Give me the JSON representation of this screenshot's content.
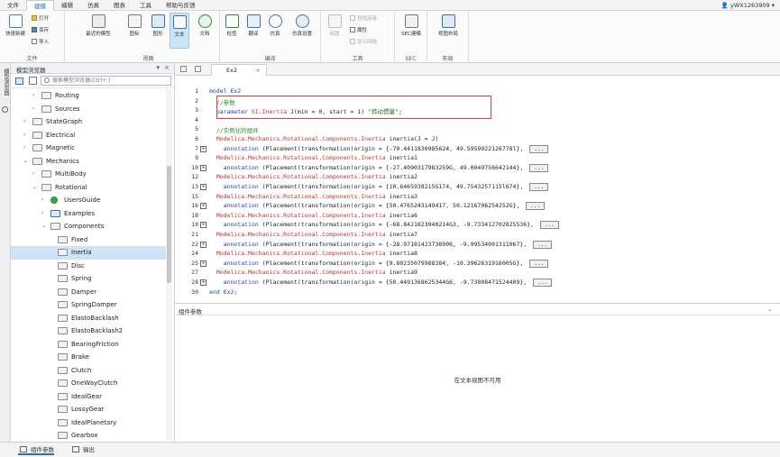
{
  "menubar": {
    "items": [
      "文件",
      "建模",
      "编辑",
      "仿真",
      "图表",
      "工具",
      "帮助与反馈"
    ],
    "active_index": 1,
    "user": "yWX1263909"
  },
  "ribbon": {
    "groups": {
      "file": {
        "label": "文件",
        "quick_new": "快速新建",
        "open": "打开",
        "save": "保存",
        "import": "导入"
      },
      "view": {
        "label": "视图",
        "recent": "最近的模型",
        "icon": "图标",
        "diagram": "图形",
        "text": "文本",
        "doc": "文档"
      },
      "compile": {
        "label": "编译",
        "check": "检查",
        "translate": "翻译",
        "simulate": "仿真",
        "sim_settings": "仿真设置"
      },
      "tools": {
        "label": "工具",
        "draw": "绘图",
        "find_conn": "查找连接",
        "props": "属性",
        "show_grid": "显示网格"
      },
      "sec": {
        "label": "SEC",
        "sec_model": "SEC建模"
      },
      "layout": {
        "label": "布局",
        "view_layout": "视图布局"
      }
    }
  },
  "sidebar": {
    "vertical_tab": "模型浏览器",
    "title": "模型浏览器",
    "search_placeholder": "搜索模型浏览器(Ctrl+;)",
    "tree": [
      {
        "label": "Routing",
        "depth": 2,
        "arrow": "›",
        "icon": "folder"
      },
      {
        "label": "Sources",
        "depth": 2,
        "arrow": "›",
        "icon": "folder"
      },
      {
        "label": "StateGraph",
        "depth": 1,
        "arrow": "›",
        "icon": "folder"
      },
      {
        "label": "Electrical",
        "depth": 1,
        "arrow": "›",
        "icon": "folder"
      },
      {
        "label": "Magnetic",
        "depth": 1,
        "arrow": "›",
        "icon": "folder"
      },
      {
        "label": "Mechanics",
        "depth": 1,
        "arrow": "⌄",
        "icon": "folder"
      },
      {
        "label": "MultiBody",
        "depth": 2,
        "arrow": "›",
        "icon": "folder"
      },
      {
        "label": "Rotational",
        "depth": 2,
        "arrow": "⌄",
        "icon": "folder"
      },
      {
        "label": "UsersGuide",
        "depth": 3,
        "arrow": "›",
        "icon": "info"
      },
      {
        "label": "Examples",
        "depth": 3,
        "arrow": "›",
        "icon": "play"
      },
      {
        "label": "Components",
        "depth": 3,
        "arrow": "⌄",
        "icon": "folder"
      },
      {
        "label": "Fixed",
        "depth": 4,
        "arrow": "",
        "icon": "component"
      },
      {
        "label": "Inertia",
        "depth": 4,
        "arrow": "",
        "icon": "component",
        "selected": true
      },
      {
        "label": "Disc",
        "depth": 4,
        "arrow": "",
        "icon": "component"
      },
      {
        "label": "Spring",
        "depth": 4,
        "arrow": "",
        "icon": "component"
      },
      {
        "label": "Damper",
        "depth": 4,
        "arrow": "",
        "icon": "component"
      },
      {
        "label": "SpringDamper",
        "depth": 4,
        "arrow": "",
        "icon": "component"
      },
      {
        "label": "ElastoBacklash",
        "depth": 4,
        "arrow": "",
        "icon": "component"
      },
      {
        "label": "ElastoBacklash2",
        "depth": 4,
        "arrow": "",
        "icon": "component"
      },
      {
        "label": "BearingFriction",
        "depth": 4,
        "arrow": "",
        "icon": "component"
      },
      {
        "label": "Brake",
        "depth": 4,
        "arrow": "",
        "icon": "component"
      },
      {
        "label": "Clutch",
        "depth": 4,
        "arrow": "",
        "icon": "component"
      },
      {
        "label": "OneWayClutch",
        "depth": 4,
        "arrow": "",
        "icon": "component"
      },
      {
        "label": "IdealGear",
        "depth": 4,
        "arrow": "",
        "icon": "component"
      },
      {
        "label": "LossyGear",
        "depth": 4,
        "arrow": "",
        "icon": "component"
      },
      {
        "label": "IdealPlanetary",
        "depth": 4,
        "arrow": "",
        "icon": "component"
      },
      {
        "label": "Gearbox",
        "depth": 4,
        "arrow": "",
        "icon": "component"
      }
    ]
  },
  "editor": {
    "tab": "Ex2",
    "lines": [
      {
        "n": "1",
        "parts": [
          {
            "c": "kw",
            "t": "model Ex2"
          }
        ]
      },
      {
        "n": "2",
        "parts": [
          {
            "c": "cm",
            "t": "  //参数"
          }
        ]
      },
      {
        "n": "3",
        "parts": [
          {
            "c": "kw",
            "t": "  parameter "
          },
          {
            "c": "tp",
            "t": "SI.Inertia"
          },
          {
            "c": "",
            "t": " J(min = 0, start = 1) "
          },
          {
            "c": "st",
            "t": "\"转动惯量\""
          },
          {
            "c": "",
            "t": ";"
          }
        ]
      },
      {
        "n": "4",
        "parts": []
      },
      {
        "n": "5",
        "parts": [
          {
            "c": "cm",
            "t": "  //实例化的组件"
          }
        ]
      },
      {
        "n": "6",
        "parts": [
          {
            "c": "tp",
            "t": "  Modelica.Mechanics.Rotational.Components.Inertia"
          },
          {
            "c": "",
            "t": " inertia(J = J)"
          }
        ]
      },
      {
        "n": "7",
        "fold": true,
        "parts": [
          {
            "c": "kw",
            "t": "    annotation"
          },
          {
            "c": "",
            "t": " (Placement(transformation(origin = {-70.4411830985624, 49.5959922126778l}, "
          }
        ],
        "ellip": "..."
      },
      {
        "n": "9",
        "parts": [
          {
            "c": "tp",
            "t": "  Modelica.Mechanics.Rotational.Components.Inertia"
          },
          {
            "c": "",
            "t": " inertia1"
          }
        ]
      },
      {
        "n": "10",
        "fold": true,
        "parts": [
          {
            "c": "kw",
            "t": "    annotation"
          },
          {
            "c": "",
            "t": " (Placement(transformation(origin = {-27.4090317983259G, 49.0049756642144}, "
          }
        ],
        "ellip": "..."
      },
      {
        "n": "12",
        "parts": [
          {
            "c": "tp",
            "t": "  Modelica.Mechanics.Rotational.Components.Inertia"
          },
          {
            "c": "",
            "t": " inertia2"
          }
        ]
      },
      {
        "n": "13",
        "fold": true,
        "parts": [
          {
            "c": "kw",
            "t": "    annotation"
          },
          {
            "c": "",
            "t": " (Placement(transformation(origin = {10.6465938215G174, 49.7543257115l674}, "
          }
        ],
        "ellip": "..."
      },
      {
        "n": "15",
        "parts": [
          {
            "c": "tp",
            "t": "  Modelica.Mechanics.Rotational.Components.Inertia"
          },
          {
            "c": "",
            "t": " inertia3"
          }
        ]
      },
      {
        "n": "16",
        "fold": true,
        "parts": [
          {
            "c": "kw",
            "t": "    annotation"
          },
          {
            "c": "",
            "t": " (Placement(transformation(origin = {50.4765243149417, 50.1216706254252G}, "
          }
        ],
        "ellip": "..."
      },
      {
        "n": "18",
        "parts": [
          {
            "c": "tp",
            "t": "  Modelica.Mechanics.Rotational.Components.Inertia"
          },
          {
            "c": "",
            "t": " inertia6"
          }
        ]
      },
      {
        "n": "19",
        "fold": true,
        "parts": [
          {
            "c": "kw",
            "t": "    annotation"
          },
          {
            "c": "",
            "t": " (Placement(transformation(origin = {-68.8421623940214G3, -9.733412702825536}, "
          }
        ],
        "ellip": "..."
      },
      {
        "n": "21",
        "parts": [
          {
            "c": "tp",
            "t": "  Modelica.Mechanics.Rotational.Components.Inertia"
          },
          {
            "c": "",
            "t": " inertia7"
          }
        ]
      },
      {
        "n": "22",
        "fold": true,
        "parts": [
          {
            "c": "kw",
            "t": "    annotation"
          },
          {
            "c": "",
            "t": " (Placement(transformation(origin = {-28.97181423738906, -9.99534001311067}, "
          }
        ],
        "ellip": "..."
      },
      {
        "n": "24",
        "parts": [
          {
            "c": "tp",
            "t": "  Modelica.Mechanics.Rotational.Components.Inertia"
          },
          {
            "c": "",
            "t": " inertia8"
          }
        ]
      },
      {
        "n": "25",
        "fold": true,
        "parts": [
          {
            "c": "kw",
            "t": "    annotation"
          },
          {
            "c": "",
            "t": " (Placement(transformation(origin = {9.80235079988384, -10.3962631916005G}, "
          }
        ],
        "ellip": "..."
      },
      {
        "n": "27",
        "parts": [
          {
            "c": "tp",
            "t": "  Modelica.Mechanics.Rotational.Components.Inertia"
          },
          {
            "c": "",
            "t": " inertia9"
          }
        ]
      },
      {
        "n": "28",
        "fold": true,
        "parts": [
          {
            "c": "kw",
            "t": "    annotation"
          },
          {
            "c": "",
            "t": " (Placement(transformation(origin = {50.4491368625344G6, -9.73808471524409}, "
          }
        ],
        "ellip": "..."
      },
      {
        "n": "30",
        "parts": [
          {
            "c": "kw",
            "t": "end Ex2;"
          }
        ]
      }
    ]
  },
  "params": {
    "title": "组件参数",
    "message": "在文本视图不可用"
  },
  "bottom_tabs": [
    "组件参数",
    "输出"
  ],
  "colors": {
    "accent": "#2a6ebb",
    "highlight_box": "#e23d3d",
    "keyword": "#1d3fbf",
    "type": "#c4322b",
    "comment": "#2f8a2f"
  }
}
